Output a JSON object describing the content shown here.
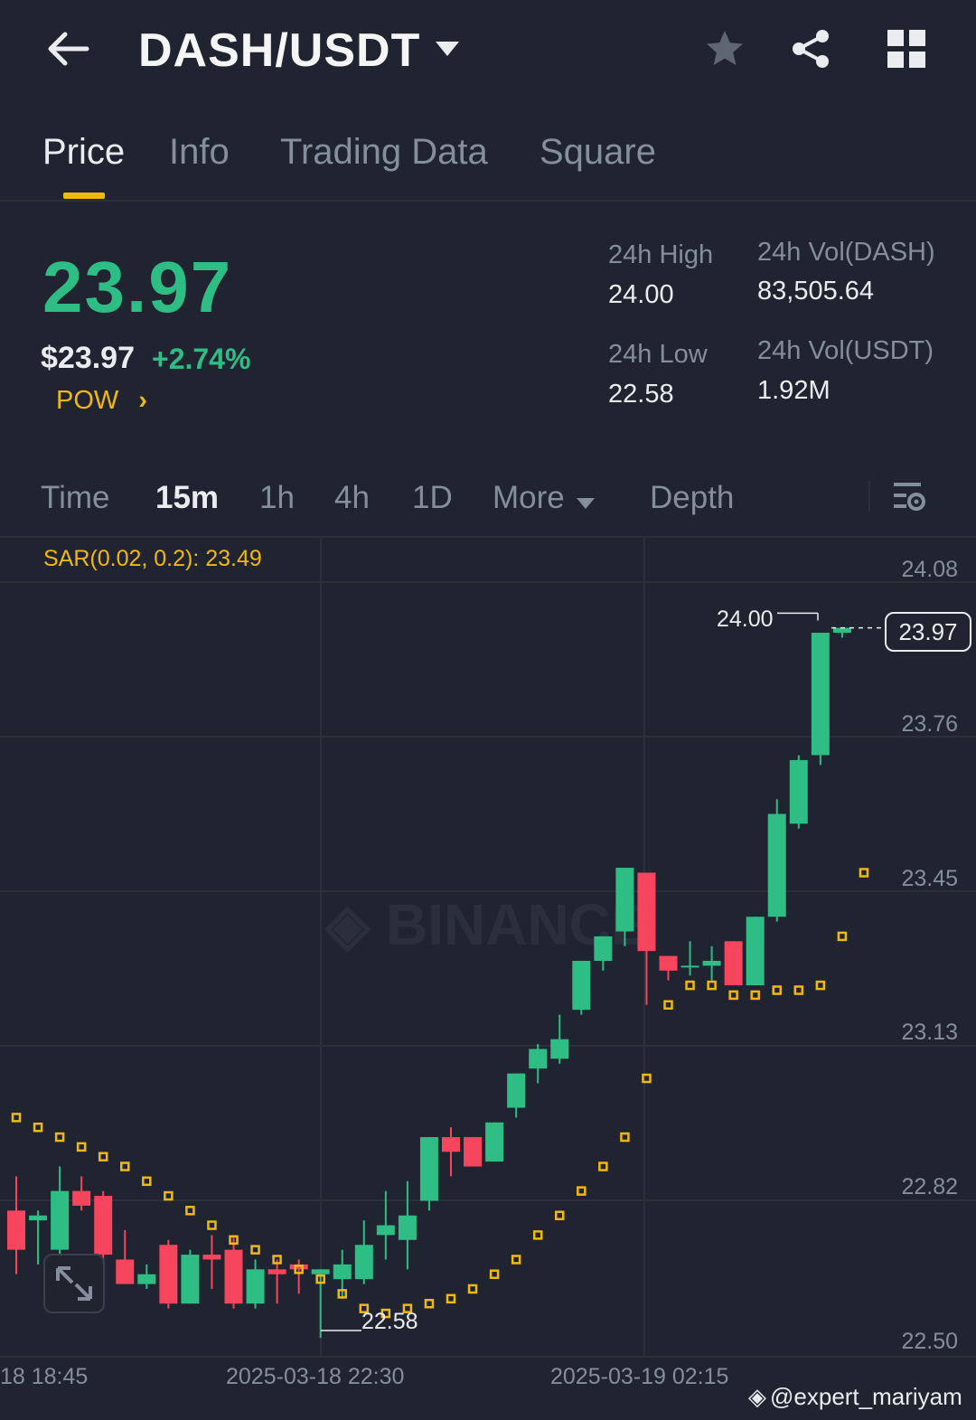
{
  "header": {
    "title": "DASH/USDT"
  },
  "tabs": [
    {
      "label": "Price"
    },
    {
      "label": "Info"
    },
    {
      "label": "Trading Data"
    },
    {
      "label": "Square"
    }
  ],
  "ticker": {
    "last_price": "23.97",
    "usd_price": "$23.97",
    "change_pct": "+2.74%",
    "tag": "POW",
    "high_label": "24h High",
    "high": "24.00",
    "low_label": "24h Low",
    "low": "22.58",
    "vol_base_label": "24h Vol(DASH)",
    "vol_base": "83,505.64",
    "vol_quote_label": "24h Vol(USDT)",
    "vol_quote": "1.92M"
  },
  "timeframes": [
    {
      "label": "Time"
    },
    {
      "label": "15m"
    },
    {
      "label": "1h"
    },
    {
      "label": "4h"
    },
    {
      "label": "1D"
    },
    {
      "label": "More"
    },
    {
      "label": "Depth"
    }
  ],
  "colors": {
    "up": "#2ebd85",
    "down": "#f6465d",
    "sar": "#f0b90b",
    "accent": "#f0b90b",
    "bg": "#1f2430"
  },
  "chart_data": {
    "type": "candlestick",
    "indicator": "SAR(0.02, 0.2): 23.49",
    "y_ticks": [
      "24.08",
      "23.76",
      "23.45",
      "23.13",
      "22.82",
      "22.50"
    ],
    "ylim": [
      22.5,
      24.08
    ],
    "x_ticks": [
      "18 18:45",
      "2025-03-18 22:30",
      "2025-03-19 02:15"
    ],
    "high_marker": "24.00",
    "low_marker": "22.58",
    "last_price_label": "23.97",
    "candles": [
      [
        22.78,
        22.85,
        22.65,
        22.7
      ],
      [
        22.76,
        22.78,
        22.67,
        22.77
      ],
      [
        22.7,
        22.87,
        22.69,
        22.82
      ],
      [
        22.82,
        22.85,
        22.78,
        22.79
      ],
      [
        22.81,
        22.82,
        22.67,
        22.69
      ],
      [
        22.68,
        22.74,
        22.63,
        22.63
      ],
      [
        22.63,
        22.67,
        22.62,
        22.65
      ],
      [
        22.71,
        22.72,
        22.58,
        22.59
      ],
      [
        22.59,
        22.7,
        22.59,
        22.69
      ],
      [
        22.69,
        22.73,
        22.62,
        22.68
      ],
      [
        22.7,
        22.73,
        22.58,
        22.59
      ],
      [
        22.59,
        22.68,
        22.58,
        22.66
      ],
      [
        22.66,
        22.68,
        22.59,
        22.65
      ],
      [
        22.67,
        22.68,
        22.61,
        22.66
      ],
      [
        22.65,
        22.66,
        22.52,
        22.66
      ],
      [
        22.64,
        22.7,
        22.6,
        22.67
      ],
      [
        22.64,
        22.76,
        22.63,
        22.71
      ],
      [
        22.73,
        22.82,
        22.68,
        22.75
      ],
      [
        22.72,
        22.84,
        22.66,
        22.77
      ],
      [
        22.8,
        22.93,
        22.78,
        22.93
      ],
      [
        22.93,
        22.95,
        22.85,
        22.9
      ],
      [
        22.93,
        22.93,
        22.87,
        22.87
      ],
      [
        22.88,
        22.96,
        22.88,
        22.96
      ],
      [
        22.99,
        23.06,
        22.97,
        23.06
      ],
      [
        23.07,
        23.12,
        23.04,
        23.11
      ],
      [
        23.09,
        23.18,
        23.08,
        23.13
      ],
      [
        23.19,
        23.29,
        23.18,
        23.29
      ],
      [
        23.29,
        23.33,
        23.27,
        23.34
      ],
      [
        23.35,
        23.48,
        23.32,
        23.48
      ],
      [
        23.47,
        23.47,
        23.2,
        23.31
      ],
      [
        23.3,
        23.29,
        23.25,
        23.27
      ],
      [
        23.28,
        23.33,
        23.26,
        23.28
      ],
      [
        23.28,
        23.32,
        23.25,
        23.29
      ],
      [
        23.33,
        23.33,
        23.24,
        23.24
      ],
      [
        23.24,
        23.38,
        23.24,
        23.38
      ],
      [
        23.38,
        23.62,
        23.37,
        23.59
      ],
      [
        23.57,
        23.71,
        23.56,
        23.7
      ],
      [
        23.71,
        23.95,
        23.69,
        23.96
      ],
      [
        23.96,
        23.97,
        23.95,
        23.97
      ]
    ],
    "sar": [
      22.97,
      22.95,
      22.93,
      22.91,
      22.89,
      22.87,
      22.84,
      22.81,
      22.78,
      22.75,
      22.72,
      22.7,
      22.68,
      22.66,
      22.64,
      22.61,
      22.58,
      22.57,
      22.58,
      22.59,
      22.6,
      22.62,
      22.65,
      22.68,
      22.73,
      22.77,
      22.82,
      22.87,
      22.93,
      23.05,
      23.2,
      23.24,
      23.24,
      23.22,
      23.22,
      23.23,
      23.23,
      23.24,
      23.34,
      23.47
    ]
  },
  "footer": {
    "watermark": "@expert_mariyam"
  }
}
